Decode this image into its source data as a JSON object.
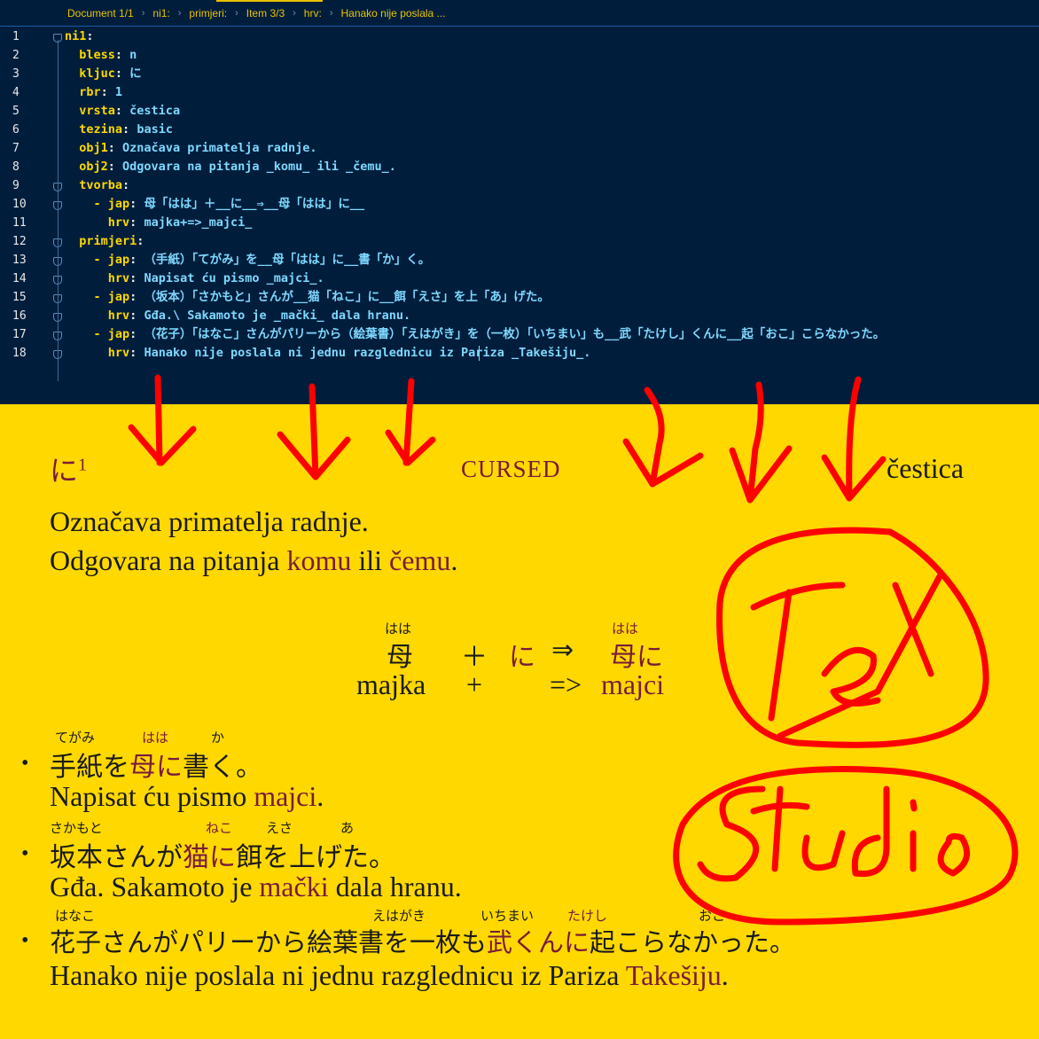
{
  "breadcrumb": [
    "Document 1/1",
    "ni1:",
    "primjeri:",
    "Item 3/3",
    "hrv:",
    "Hanako nije poslala ..."
  ],
  "editor": {
    "line_numbers": [
      "1",
      "2",
      "3",
      "4",
      "5",
      "6",
      "7",
      "8",
      "9",
      "10",
      "11",
      "12",
      "13",
      "14",
      "15",
      "16",
      "17",
      "18"
    ],
    "lines": [
      {
        "key": "ni1",
        "value": ""
      },
      {
        "key": "bless",
        "value": "n"
      },
      {
        "key": "kljuc",
        "value": "に"
      },
      {
        "key": "rbr",
        "value": "1"
      },
      {
        "key": "vrsta",
        "value": "čestica"
      },
      {
        "key": "tezina",
        "value": "basic"
      },
      {
        "key": "obj1",
        "value": "Označava primatelja radnje."
      },
      {
        "key": "obj2",
        "value": "Odgovara na pitanja _komu_ ili _čemu_."
      },
      {
        "key": "tvorba",
        "value": ""
      },
      {
        "key": "jap",
        "value": "母「はは」＋__に__⇒__母「はは」に__"
      },
      {
        "key": "hrv",
        "value": "majka+=>_majci_"
      },
      {
        "key": "primjeri",
        "value": ""
      },
      {
        "key": "jap",
        "value": "（手紙）「てがみ」を__母「はは」に__書「か」く。"
      },
      {
        "key": "hrv",
        "value": "Napisat ću pismo _majci_."
      },
      {
        "key": "jap",
        "value": "（坂本）「さかもと」さんが__猫「ねこ」に__餌「えさ」を上「あ」げた。"
      },
      {
        "key": "hrv",
        "value": "Gđa.\\ Sakamoto je _mački_ dala hranu."
      },
      {
        "key": "jap",
        "value": "（花子）「はなこ」さんがパリーから（絵葉書）「えはがき」を（一枚）「いちまい」も__武「たけし」くんに__起「おこ」こらなかった。"
      },
      {
        "key": "hrv",
        "value": "Hanako nije poslala ni jednu razglednicu iz Pariza _Takešiju_."
      }
    ]
  },
  "preview": {
    "headword": "に",
    "headword_sup": "1",
    "label": "CURSED",
    "category": "čestica",
    "obj1": "Označava primatelja radnje.",
    "obj2_pre": "Odgovara na pitanja ",
    "obj2_w1": "komu",
    "obj2_mid": " ili ",
    "obj2_w2": "čemu",
    "obj2_post": ".",
    "formula": {
      "jp_haha": "母",
      "ruby_haha": "はは",
      "plus": "＋",
      "ni": "に",
      "arrow": "⇒",
      "jp_result": "母に",
      "ruby_result": "はは",
      "hr_majka": "majka",
      "hr_plus": "+",
      "hr_arrow": "=>",
      "hr_result": "majci"
    },
    "examples": [
      {
        "jp_a": "手紙を",
        "jp_acc": "母に",
        "jp_b": "書く。",
        "ruby": [
          "てがみ",
          "はは",
          "か"
        ],
        "hr_a": "Napisat ću pismo ",
        "hr_acc": "majci",
        "hr_b": "."
      },
      {
        "jp_a": "坂本さんが",
        "jp_acc": "猫に",
        "jp_b": "餌を上げた。",
        "ruby": [
          "さかもと",
          "ねこ",
          "えさ",
          "あ"
        ],
        "hr_a": "Gđa. Sakamoto je ",
        "hr_acc": "mački",
        "hr_b": " dala hranu."
      },
      {
        "jp_a": "花子さんがパリーから絵葉書を一枚も",
        "jp_acc": "武くんに",
        "jp_b": "起こらなかった。",
        "ruby": [
          "はなこ",
          "えはがき",
          "いちまい",
          "たけし",
          "おこ"
        ],
        "hr_a": "Hanako nije poslala ni jednu razglednicu iz Pariza ",
        "hr_acc": "Takešiju",
        "hr_b": "."
      }
    ]
  },
  "annotation": {
    "word1": "TeX",
    "word2": "Studio",
    "color": "#ff0000"
  },
  "colors": {
    "editor_bg": "#001e3c",
    "key": "#ffd700",
    "value": "#7fd8ff",
    "preview_bg": "#ffd800",
    "accent": "#7a1a3a"
  }
}
